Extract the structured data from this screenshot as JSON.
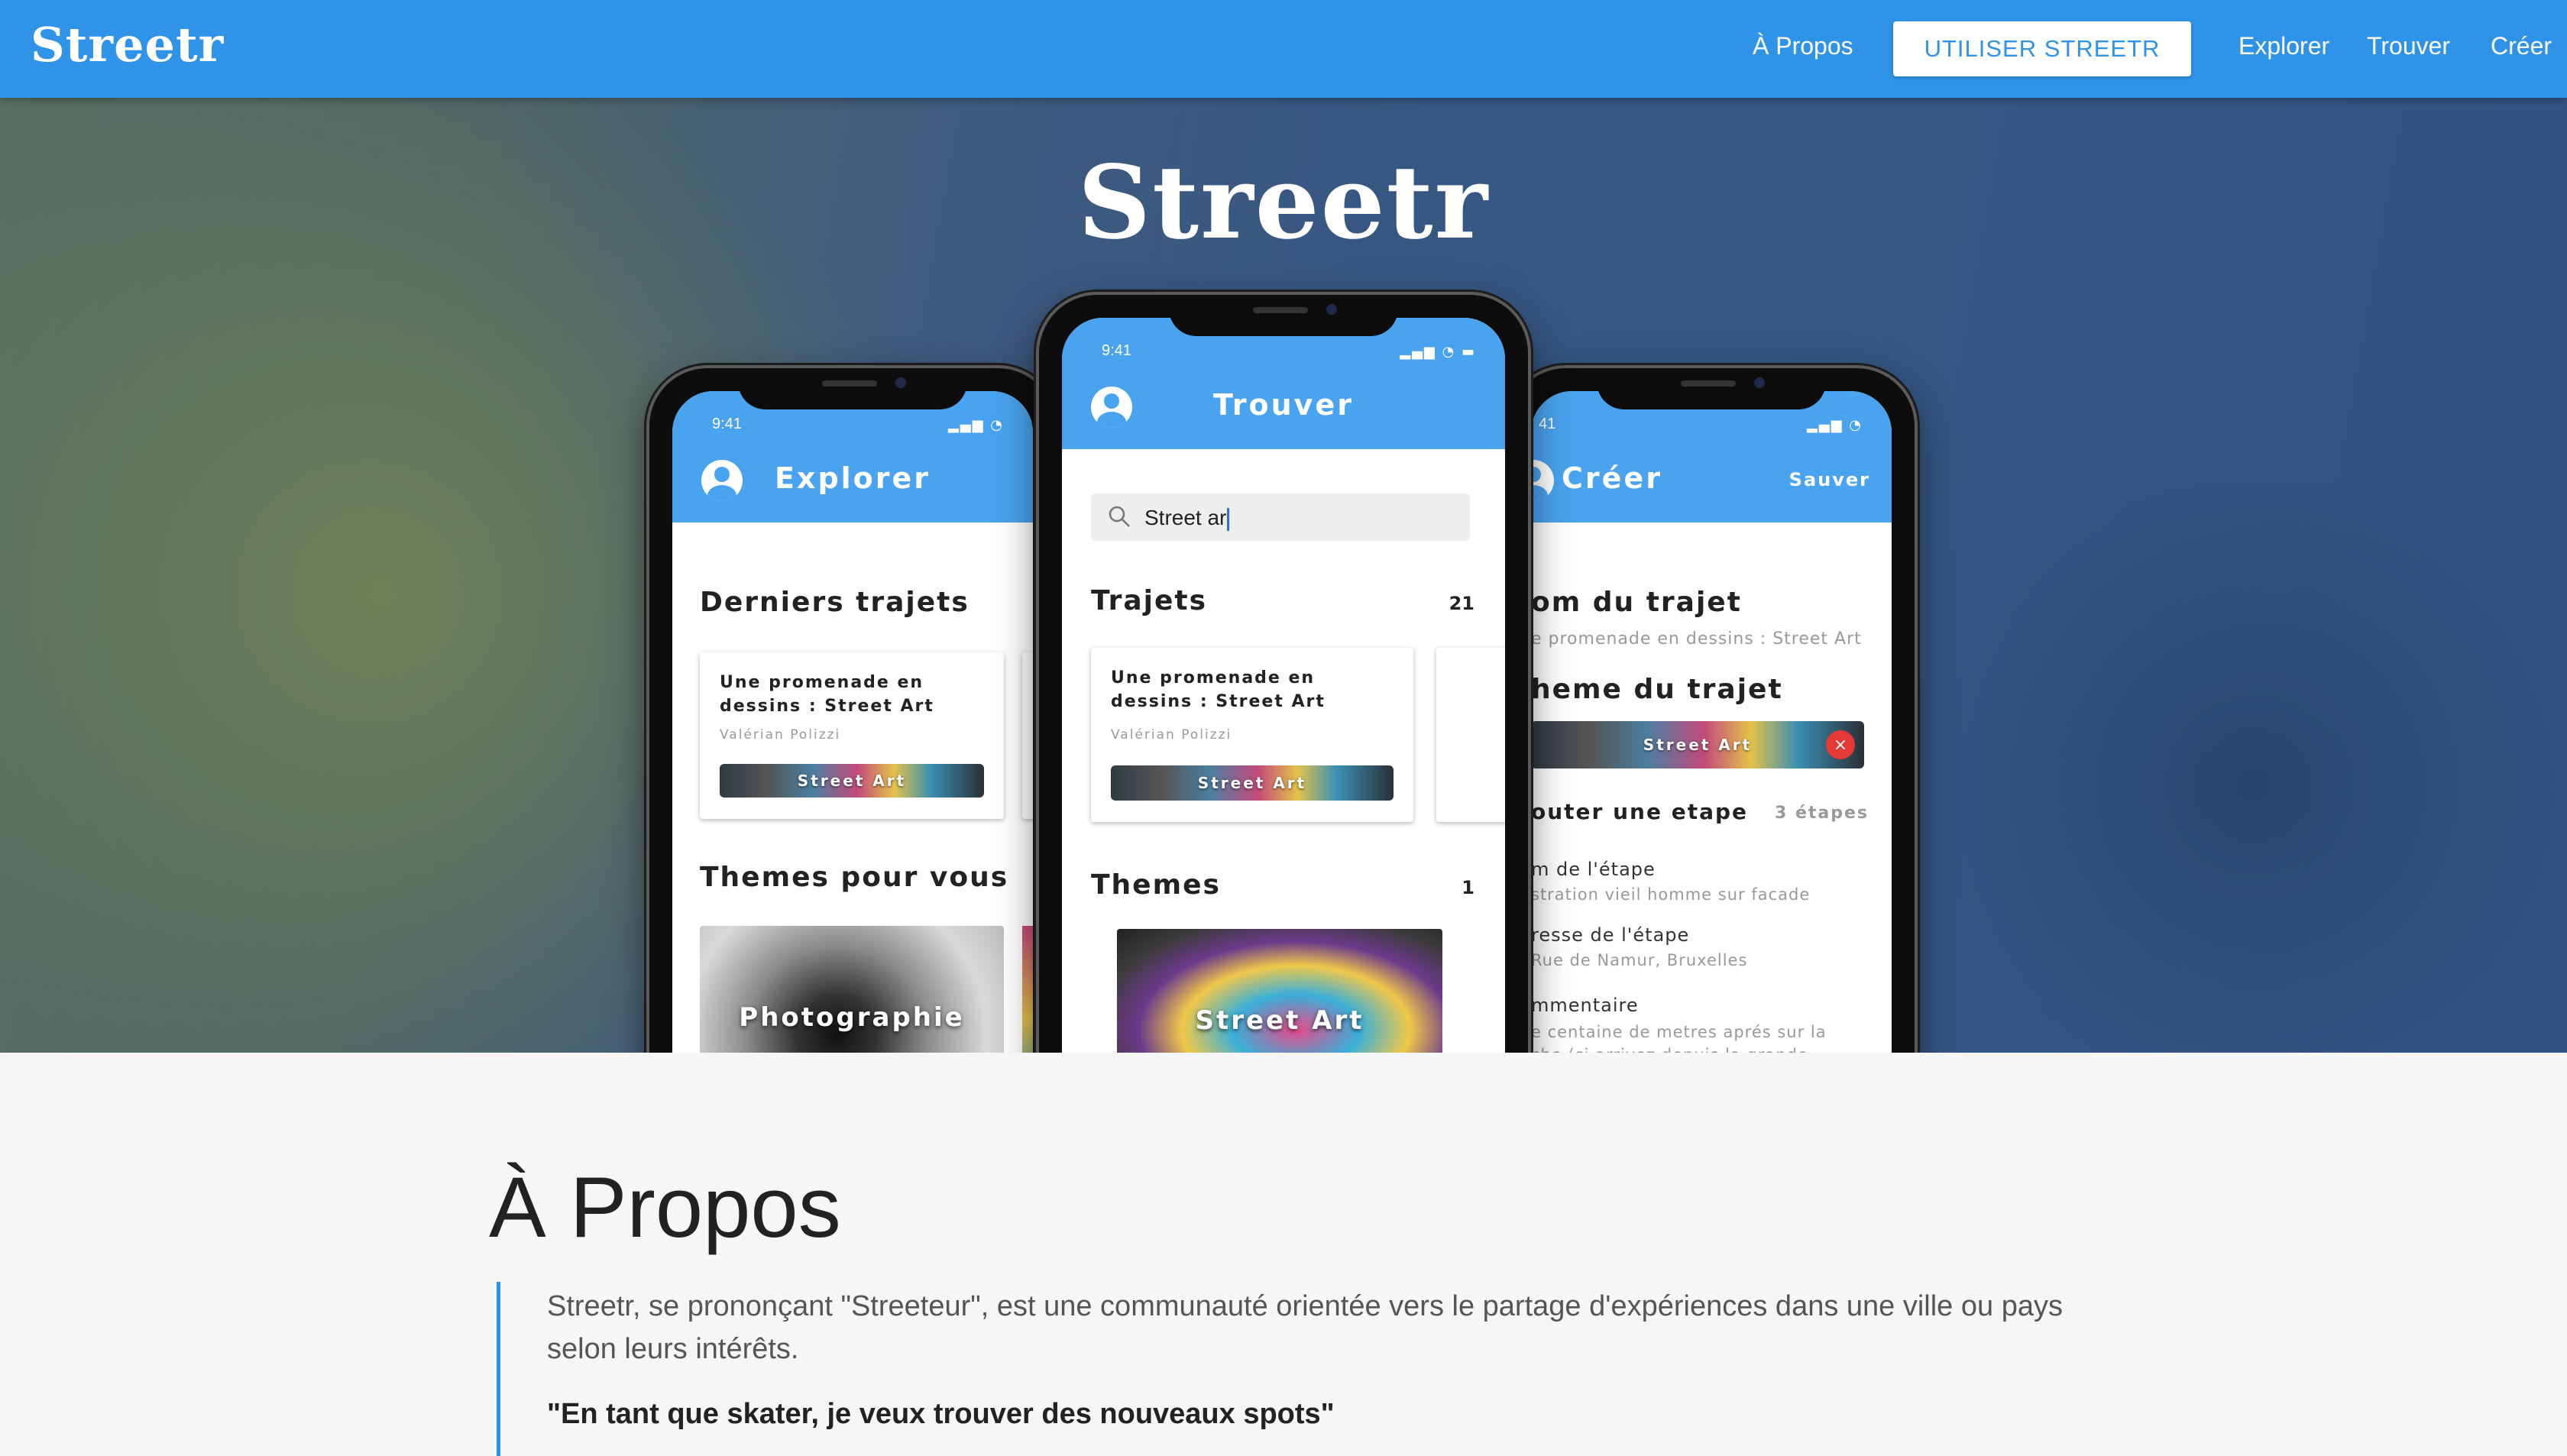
{
  "nav": {
    "brand": "Streetr",
    "about": "À Propos",
    "cta": "UTILISER STREETR",
    "explore": "Explorer",
    "find": "Trouver",
    "create": "Créer"
  },
  "hero": {
    "title": "Streetr"
  },
  "phone_common": {
    "time": "9:41",
    "time_cropped": "41",
    "tag_label": "Street Art"
  },
  "phone_explore": {
    "header": "Explorer",
    "recent_title": "Derniers trajets",
    "card_title": "Une promenade en dessins : Street Art",
    "card_author": "Valérian Polizzi",
    "themes_title": "Themes pour vous",
    "theme_label": "Photographie"
  },
  "phone_find": {
    "header": "Trouver",
    "search_value": "Street ar",
    "trips_title": "Trajets",
    "trips_count": "21",
    "card_title": "Une promenade en dessins : Street Art",
    "card_author": "Valérian Polizzi",
    "themes_title": "Themes",
    "themes_count": "1",
    "theme_label": "Street Art"
  },
  "phone_create": {
    "header": "Créer",
    "save": "Sauver",
    "name_label": "om du trajet",
    "name_value": "e promenade en dessins : Street Art",
    "theme_label": "heme du trajet",
    "step_label": "outer une etape",
    "step_count": "3 étapes",
    "step_name_label": "m de l'étape",
    "step_name_value": "stration vieil homme sur facade",
    "address_label": "resse de l'étape",
    "address_value": "Rue de Namur, Bruxelles",
    "comment_label": "mmentaire",
    "comment_line1": "e centaine de metres aprés sur la",
    "comment_line2": "che (si arrivez depuis la grande"
  },
  "about": {
    "title": "À Propos",
    "text": "Streetr, se prononçant \"Streeteur\", est une communauté orientée vers le partage d'expériences dans une ville ou pays selon leurs intérêts.",
    "quote": "\"En tant que skater, je veux trouver des nouveaux spots\""
  },
  "colors": {
    "primary": "#2f93e8",
    "app_header": "#4aa3ee",
    "delete": "#e53935"
  },
  "icons": [
    "user-avatar-icon",
    "search-icon",
    "close-icon",
    "signal-icon",
    "wifi-icon",
    "battery-icon"
  ]
}
